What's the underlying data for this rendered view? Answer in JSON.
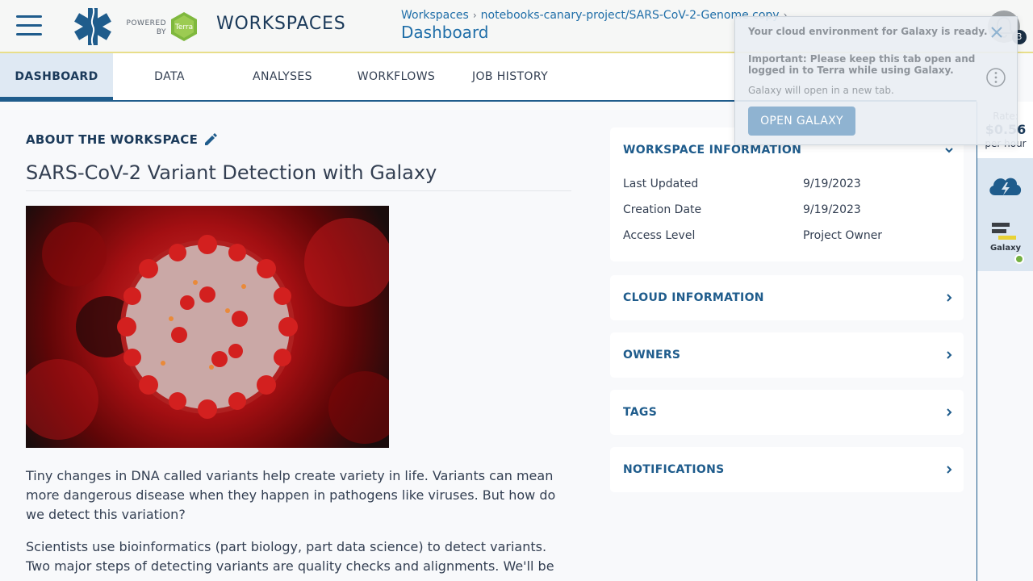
{
  "header": {
    "menu_icon": "hamburger-menu-icon",
    "powered_by": "POWERED BY",
    "terra_logo_text": "Terra",
    "app_title": "WORKSPACES",
    "breadcrumbs": [
      "Workspaces",
      "notebooks-canary-project/SARS-CoV-2-Genome copy"
    ],
    "page_title": "Dashboard",
    "notification_count": "3"
  },
  "tabs": [
    {
      "label": "DASHBOARD",
      "active": true
    },
    {
      "label": "DATA"
    },
    {
      "label": "ANALYSES"
    },
    {
      "label": "WORKFLOWS"
    },
    {
      "label": "JOB HISTORY"
    }
  ],
  "rail": {
    "rate_label": "Rate:",
    "rate_value": "$0.56",
    "rate_unit": "per hour",
    "galaxy_label": "Galaxy",
    "galaxy_status_color": "#74b041"
  },
  "about": {
    "section_label": "ABOUT THE WORKSPACE",
    "title": "SARS-CoV-2 Variant Detection with Galaxy",
    "paragraphs": [
      "Tiny changes in DNA called variants help create variety in life. Variants can mean more dangerous disease when they happen in pathogens like viruses. But how do we detect this variation?",
      "Scientists use bioinformatics (part biology, part data science) to detect variants. Two major steps of detecting variants are quality checks and alignments. We'll be"
    ]
  },
  "workspace_info": {
    "heading": "WORKSPACE INFORMATION",
    "rows": [
      {
        "key": "Last Updated",
        "value": "9/19/2023"
      },
      {
        "key": "Creation Date",
        "value": "9/19/2023"
      },
      {
        "key": "Access Level",
        "value": "Project Owner"
      }
    ]
  },
  "sections": [
    "CLOUD INFORMATION",
    "OWNERS",
    "TAGS",
    "NOTIFICATIONS"
  ],
  "toast": {
    "line1": "Your cloud environment for Galaxy is ready.",
    "line2": "Important: Please keep this tab open and logged in to Terra while using Galaxy.",
    "line3": "Galaxy will open in a new tab.",
    "button": "OPEN GALAXY"
  },
  "colors": {
    "brand": "#1f5c8c",
    "header_bg": "#f6f7f6",
    "accent_border": "#e8de8a"
  }
}
